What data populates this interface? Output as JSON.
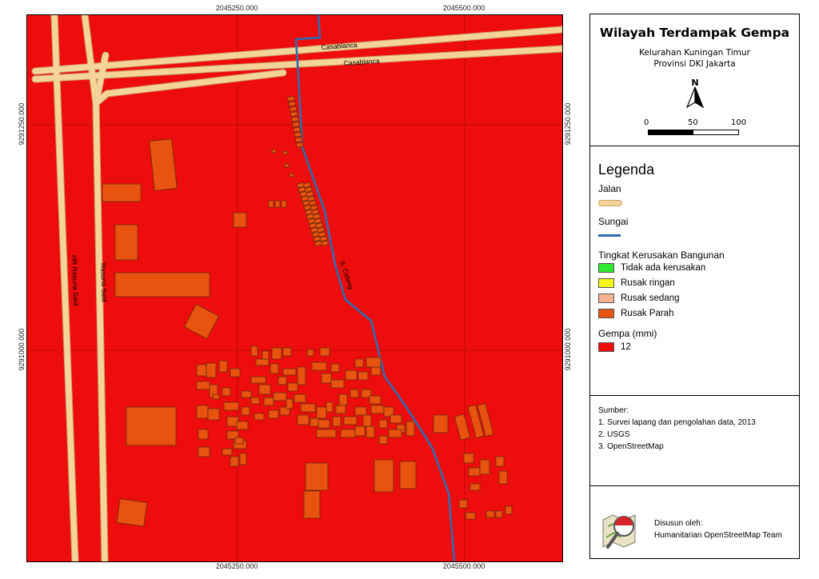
{
  "map": {
    "title": "Wilayah Terdampak Gempa",
    "subtitle_line1": "Kelurahan Kuningan Timur",
    "subtitle_line2": "Provinsi DKI Jakarta",
    "north_label": "N",
    "scale_labels": [
      "0",
      "50",
      "100"
    ],
    "coords": {
      "x_labels": [
        "2045250.000",
        "2045500.000"
      ],
      "y_labels": [
        "9291250.000",
        "9291000.000"
      ]
    },
    "streets": {
      "casablanca": "Casablanca",
      "hr_rasuna_said": "HR Rasuna Said",
      "rasuna_said": "Rasuna Said",
      "river": "S. Cideng"
    },
    "colors": {
      "background": "#ee0d0d",
      "road": "#f5d49a",
      "road_outline": "#c9a36a",
      "river": "#2f6ab0",
      "building": "#e8540f",
      "building_stroke": "#6b2a0a"
    }
  },
  "legend": {
    "heading": "Legenda",
    "jalan": "Jalan",
    "sungai": "Sungai",
    "kerusakan_title": "Tingkat Kerusakan Bangunan",
    "kerusakan_items": [
      {
        "label": "Tidak ada kerusakan",
        "color": "#2ee82e"
      },
      {
        "label": "Rusak ringan",
        "color": "#f5f51a"
      },
      {
        "label": "Rusak sedang",
        "color": "#f5b190"
      },
      {
        "label": "Rusak Parah",
        "color": "#e8540f"
      }
    ],
    "gempa_title": "Gempa (mmi)",
    "gempa_items": [
      {
        "label": "12",
        "color": "#ee0d0d"
      }
    ]
  },
  "sources": {
    "heading": "Sumber:",
    "items": [
      "1. Survei lapang dan pengolahan data, 2013",
      "2. USGS",
      "3. OpenStreetMap"
    ]
  },
  "credit": {
    "line1": "Disusun oleh:",
    "line2": "Humanitarian OpenStreetMap Team"
  }
}
